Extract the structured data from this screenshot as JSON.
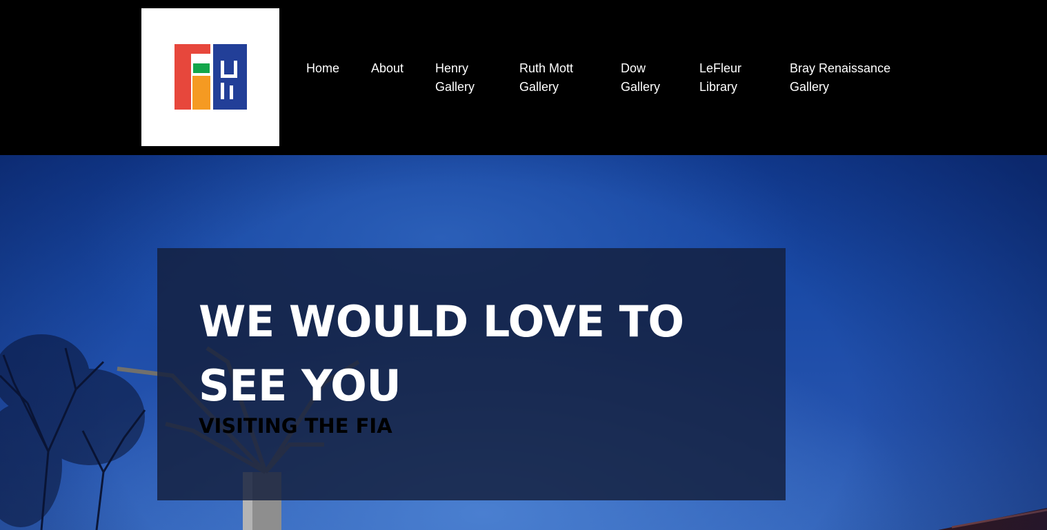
{
  "colors": {
    "header_bg": "#000000",
    "logo_red": "#e7473c",
    "logo_green": "#13a64a",
    "logo_orange": "#f59a22",
    "logo_blue": "#223f98",
    "hero_blue": "#1a4aa6"
  },
  "logo": {
    "icon": "fia-logo-icon"
  },
  "nav": {
    "items": [
      {
        "label": "Home"
      },
      {
        "label": "About"
      },
      {
        "label": "Henry\nGallery"
      },
      {
        "label": "Ruth Mott\nGallery"
      },
      {
        "label": "Dow\nGallery"
      },
      {
        "label": "LeFleur\nLibrary"
      },
      {
        "label": "Bray Renaissance\nGallery"
      }
    ]
  },
  "hero": {
    "title": "WE WOULD LOVE TO SEE YOU",
    "subtitle": "VISITING THE FIA"
  }
}
